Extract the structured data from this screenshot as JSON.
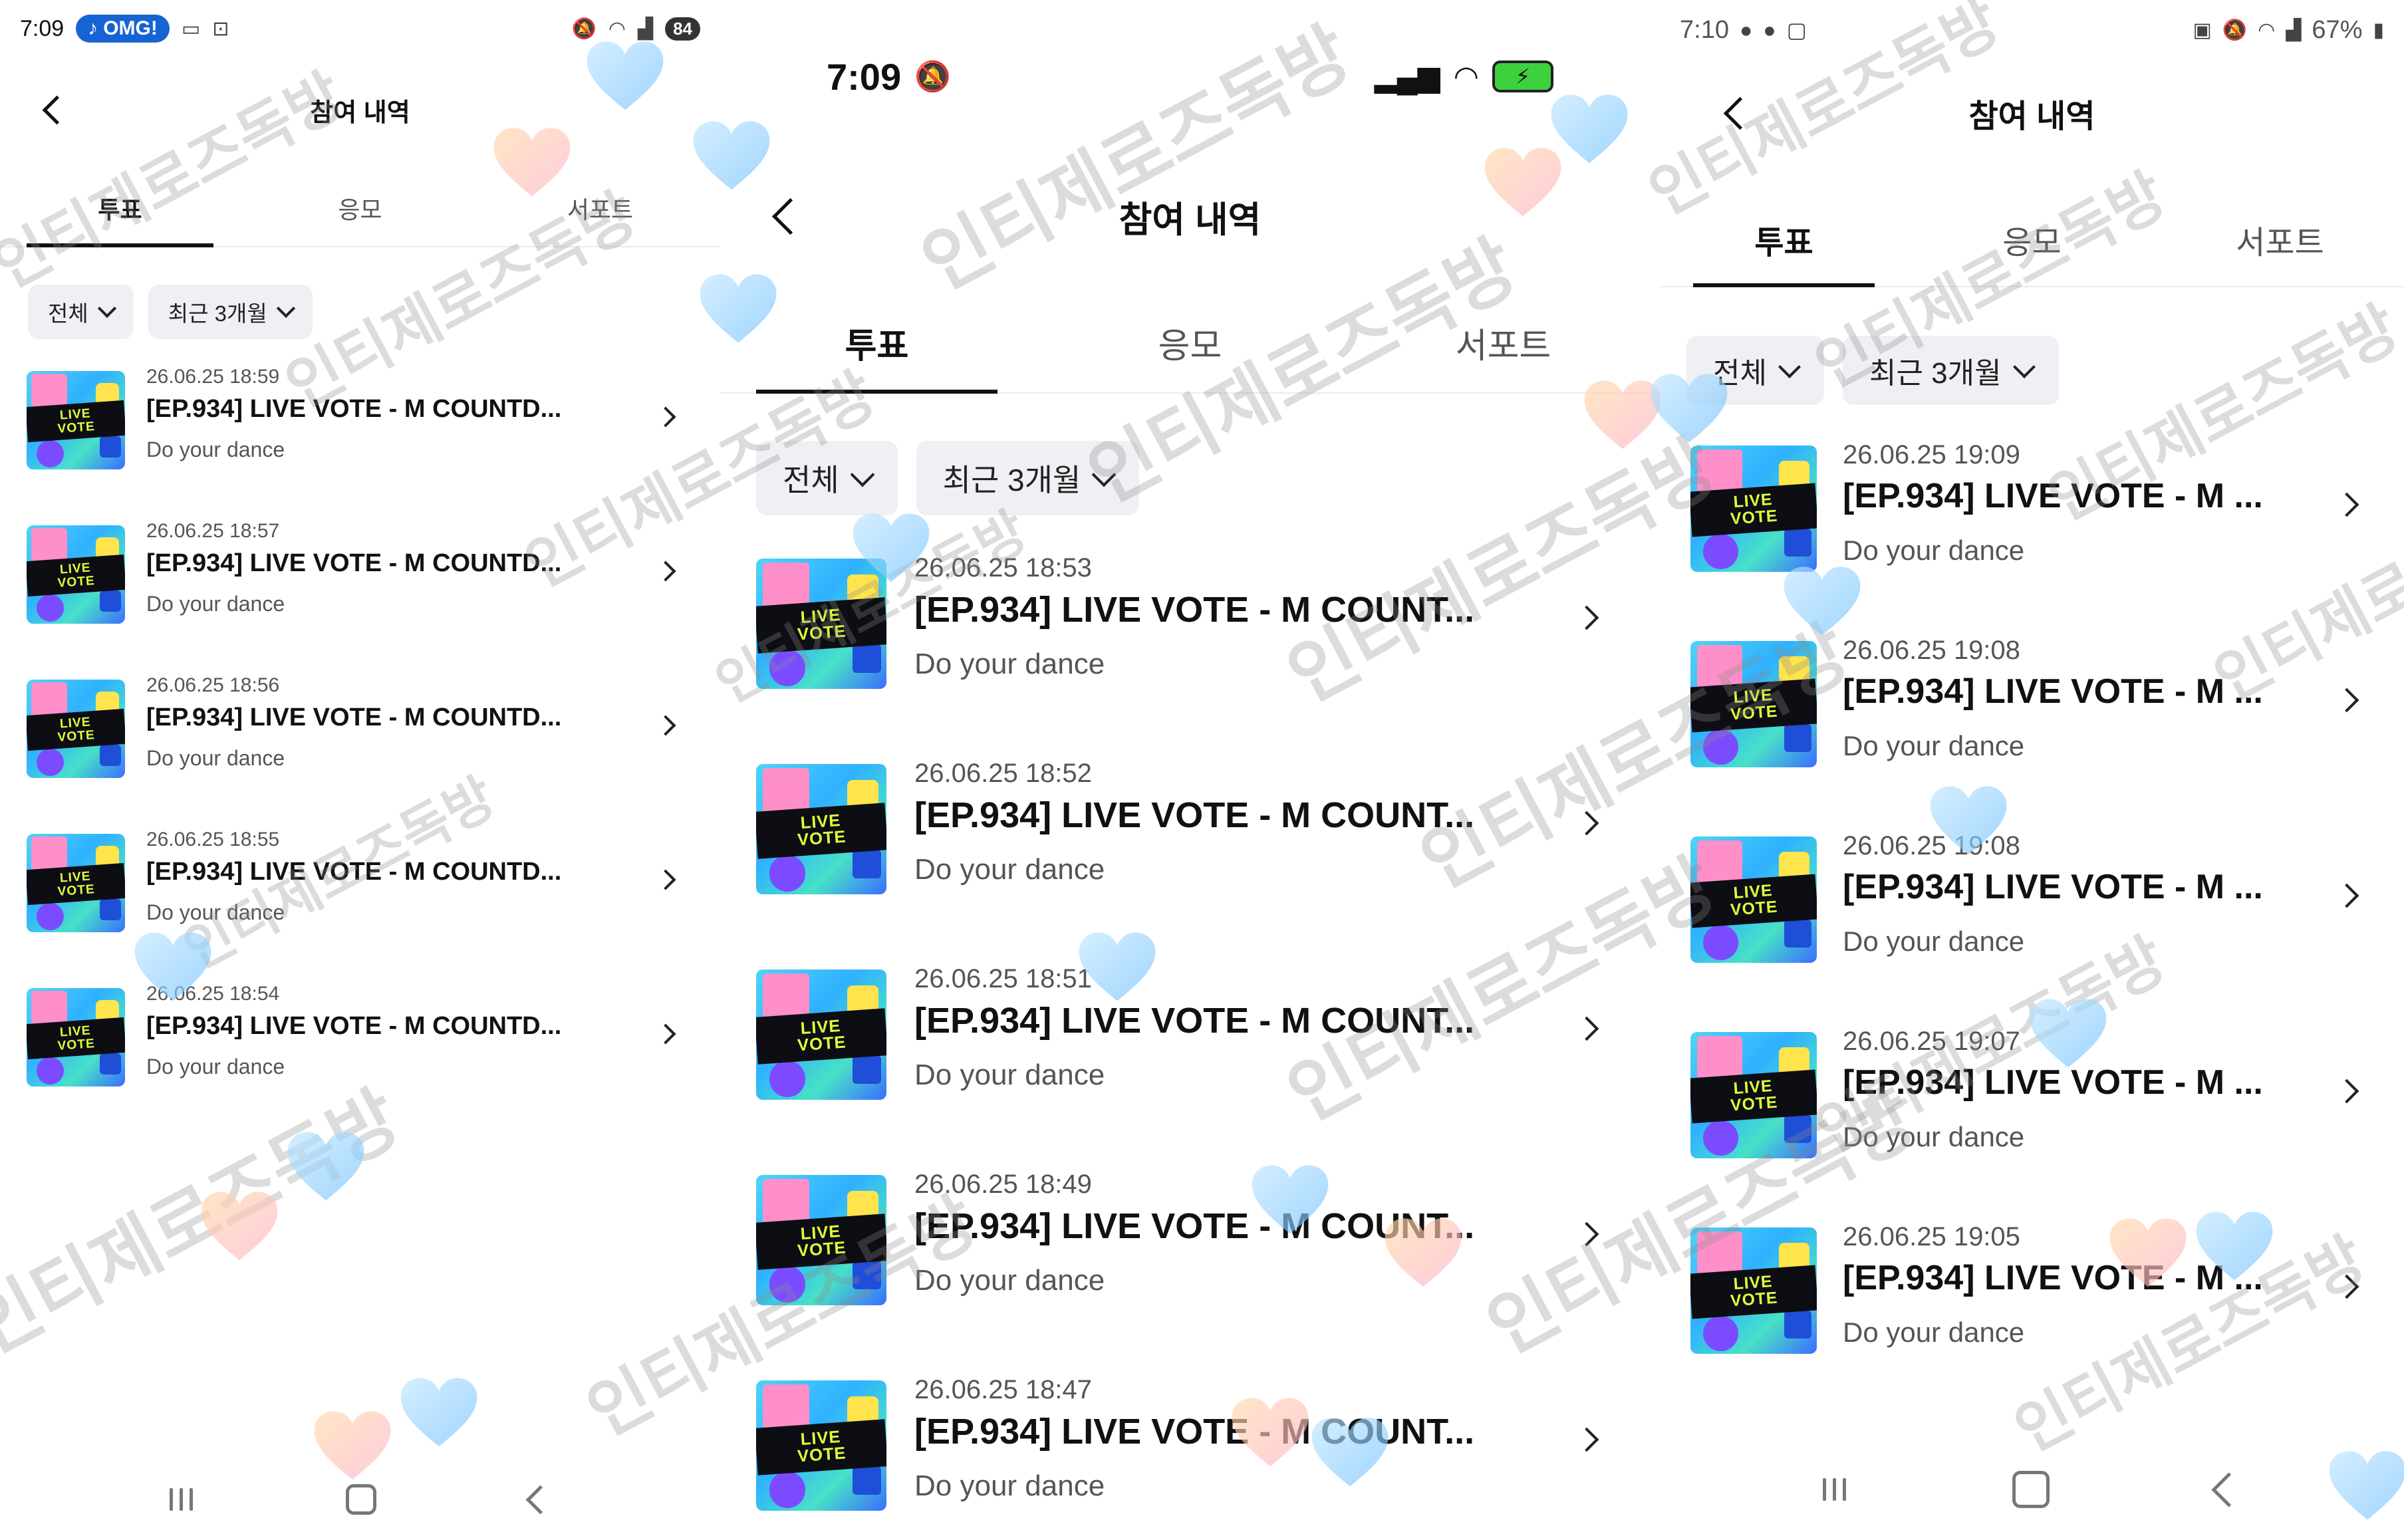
{
  "panels": [
    {
      "status": {
        "time": "7:09",
        "badge": "OMG!",
        "battery": "84"
      },
      "title": "참여 내역",
      "tabs": [
        "투표",
        "응모",
        "서포트"
      ],
      "filters": [
        "전체",
        "최근 3개월"
      ],
      "items": [
        {
          "date": "26.06.25 18:59",
          "title": "[EP.934] LIVE VOTE - M COUNTD...",
          "sub": "Do your dance"
        },
        {
          "date": "26.06.25 18:57",
          "title": "[EP.934] LIVE VOTE - M COUNTD...",
          "sub": "Do your dance"
        },
        {
          "date": "26.06.25 18:56",
          "title": "[EP.934] LIVE VOTE - M COUNTD...",
          "sub": "Do your dance"
        },
        {
          "date": "26.06.25 18:55",
          "title": "[EP.934] LIVE VOTE - M COUNTD...",
          "sub": "Do your dance"
        },
        {
          "date": "26.06.25 18:54",
          "title": "[EP.934] LIVE VOTE - M COUNTD...",
          "sub": "Do your dance"
        }
      ]
    },
    {
      "status": {
        "time": "7:09"
      },
      "title": "참여 내역",
      "tabs": [
        "투표",
        "응모",
        "서포트"
      ],
      "filters": [
        "전체",
        "최근 3개월"
      ],
      "items": [
        {
          "date": "26.06.25 18:53",
          "title": "[EP.934] LIVE VOTE - M COUNT...",
          "sub": "Do your dance"
        },
        {
          "date": "26.06.25 18:52",
          "title": "[EP.934] LIVE VOTE - M COUNT...",
          "sub": "Do your dance"
        },
        {
          "date": "26.06.25 18:51",
          "title": "[EP.934] LIVE VOTE - M COUNT...",
          "sub": "Do your dance"
        },
        {
          "date": "26.06.25 18:49",
          "title": "[EP.934] LIVE VOTE - M COUNT...",
          "sub": "Do your dance"
        },
        {
          "date": "26.06.25 18:47",
          "title": "[EP.934] LIVE VOTE - M COUNT...",
          "sub": "Do your dance"
        }
      ]
    },
    {
      "status": {
        "time": "7:10",
        "battery": "67%"
      },
      "title": "참여 내역",
      "tabs": [
        "투표",
        "응모",
        "서포트"
      ],
      "filters": [
        "전체",
        "최근 3개월"
      ],
      "items": [
        {
          "date": "26.06.25 19:09",
          "title": "[EP.934] LIVE VOTE - M ...",
          "sub": "Do your dance"
        },
        {
          "date": "26.06.25 19:08",
          "title": "[EP.934] LIVE VOTE - M ...",
          "sub": "Do your dance"
        },
        {
          "date": "26.06.25 19:08",
          "title": "[EP.934] LIVE VOTE - M ...",
          "sub": "Do your dance"
        },
        {
          "date": "26.06.25 19:07",
          "title": "[EP.934] LIVE VOTE - M ...",
          "sub": "Do your dance"
        },
        {
          "date": "26.06.25 19:05",
          "title": "[EP.934] LIVE VOTE - M ...",
          "sub": "Do your dance"
        }
      ]
    }
  ],
  "thumb_text": {
    "line1": "LIVE",
    "line2": "VOTE"
  },
  "watermark": "인티제로즈독방",
  "colors": {
    "accent_blue": "#1663d6",
    "tab_underline": "#111111",
    "chip_bg": "#eef0f3"
  }
}
